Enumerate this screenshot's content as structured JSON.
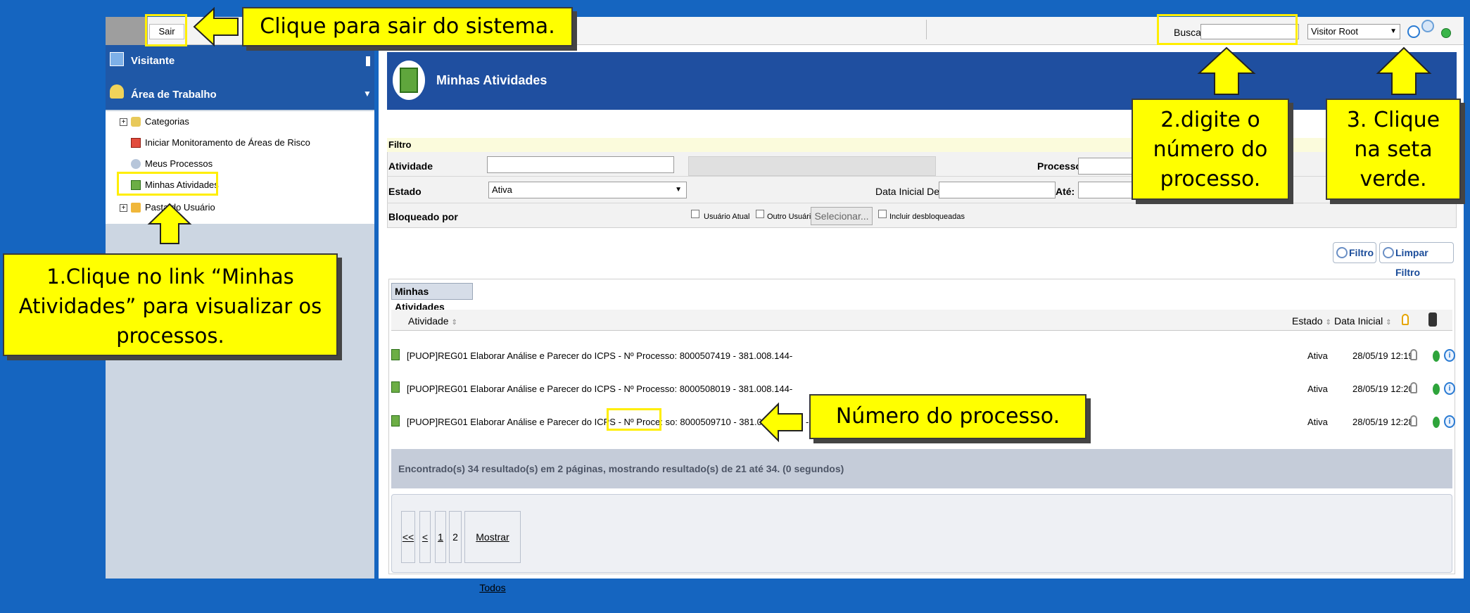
{
  "topbar": {
    "sair_label": "Sair",
    "busca_label": "Busca",
    "busca_value": "",
    "user_selected": "Visitor Root"
  },
  "sidebar": {
    "visitante_label": "Visitante",
    "desktop_label": "Área de Trabalho",
    "items": [
      {
        "label": "Categorias"
      },
      {
        "label": "Iniciar Monitoramento de Áreas de Risco"
      },
      {
        "label": "Meus Processos"
      },
      {
        "label": "Minhas Atividades"
      },
      {
        "label": "Pasta do Usuário"
      }
    ]
  },
  "header": {
    "title": "Minhas Atividades"
  },
  "filter": {
    "title": "Filtro",
    "atividade_label": "Atividade",
    "estado_label": "Estado",
    "estado_value": "Ativa",
    "bloqueado_label": "Bloqueado por",
    "processo_label": "Processo",
    "data_inicial_label": "Data Inicial De:",
    "ate_label": "Até:",
    "usuario_atual_label": "Usuário Atual",
    "outro_usuario_label": "Outro Usuário",
    "selecionar_label": "Selecionar...",
    "incluir_label": "Incluir desbloqueadas",
    "btn_filtro": "Filtro",
    "btn_limpar": "Limpar Filtro"
  },
  "list": {
    "tab_label": "Minhas Atividades",
    "columns": {
      "atividade": "Atividade",
      "estado": "Estado",
      "data_inicial": "Data Inicial"
    },
    "rows": [
      {
        "text": "[PUOP]REG01 Elaborar Análise e Parecer do ICPS - Nº Processo: 8000507419 - 381.008.144-",
        "estado": "Ativa",
        "data": "28/05/19 12:19"
      },
      {
        "text": "[PUOP]REG01 Elaborar Análise e Parecer do ICPS - Nº Processo: 8000508019 - 381.008.144-",
        "estado": "Ativa",
        "data": "28/05/19 12:20"
      },
      {
        "text": "[PUOP]REG01 Elaborar Análise e Parecer do ICPS - Nº Proce: so: 8000509710 - 381.008.144-15 - Binha teste",
        "estado": "Ativa",
        "data": "28/05/19 12:28"
      }
    ],
    "results_text": "Encontrado(s) 34 resultado(s) em 2 páginas, mostrando resultado(s) de 21 até 34. (0 segundos)",
    "pager": [
      "<<",
      "<",
      "1",
      "2",
      "Mostrar Todos"
    ]
  },
  "callouts": {
    "sair": "Clique para sair do sistema.",
    "step1": "1.Clique no link “Minhas Atividades” para visualizar os processos.",
    "step2": "2.digite o número do processo.",
    "step3": "3. Clique na seta verde.",
    "numero": "Número do processo."
  },
  "colors": {
    "background": "#1565c0",
    "header": "#1f4fa0",
    "callout": "#ffff00",
    "highlight": "#ffee00"
  }
}
